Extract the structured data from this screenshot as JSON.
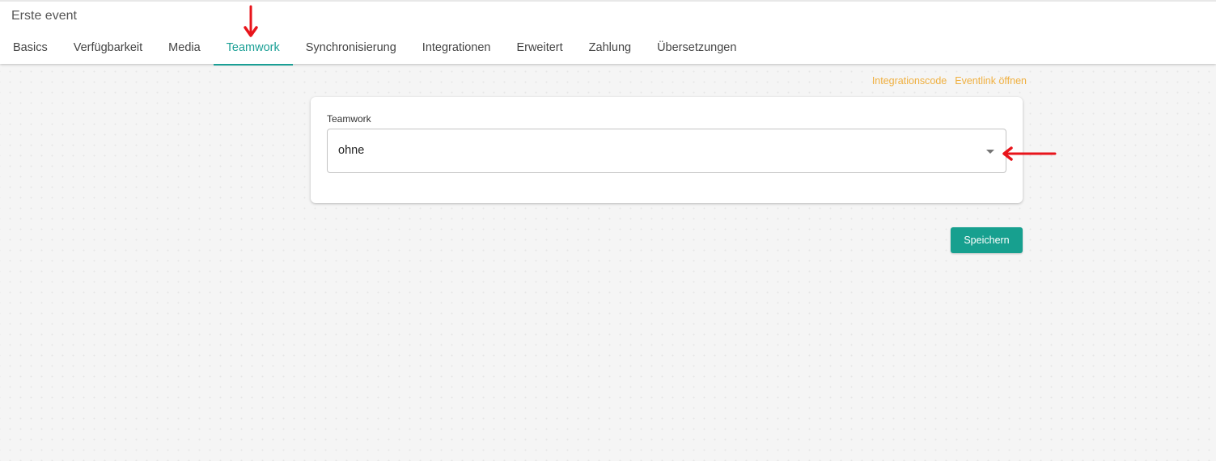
{
  "header": {
    "title": "Erste event"
  },
  "tabs": [
    {
      "label": "Basics",
      "active": false
    },
    {
      "label": "Verfügbarkeit",
      "active": false
    },
    {
      "label": "Media",
      "active": false
    },
    {
      "label": "Teamwork",
      "active": true
    },
    {
      "label": "Synchronisierung",
      "active": false
    },
    {
      "label": "Integrationen",
      "active": false
    },
    {
      "label": "Erweitert",
      "active": false
    },
    {
      "label": "Zahlung",
      "active": false
    },
    {
      "label": "Übersetzungen",
      "active": false
    }
  ],
  "links": {
    "integration_code": "Integrationscode",
    "open_event_link": "Eventlink öffnen"
  },
  "form": {
    "teamwork_label": "Teamwork",
    "teamwork_value": "ohne",
    "dropdown_icon": "caret-down-icon"
  },
  "actions": {
    "save_label": "Speichern"
  },
  "annotations": {
    "arrow_color": "#e8141b",
    "arrows": [
      "arrow-down-to-teamwork-tab",
      "arrow-left-to-dropdown"
    ]
  },
  "colors": {
    "accent": "#1a9f95",
    "link": "#f0b040",
    "button": "#17a08f"
  }
}
